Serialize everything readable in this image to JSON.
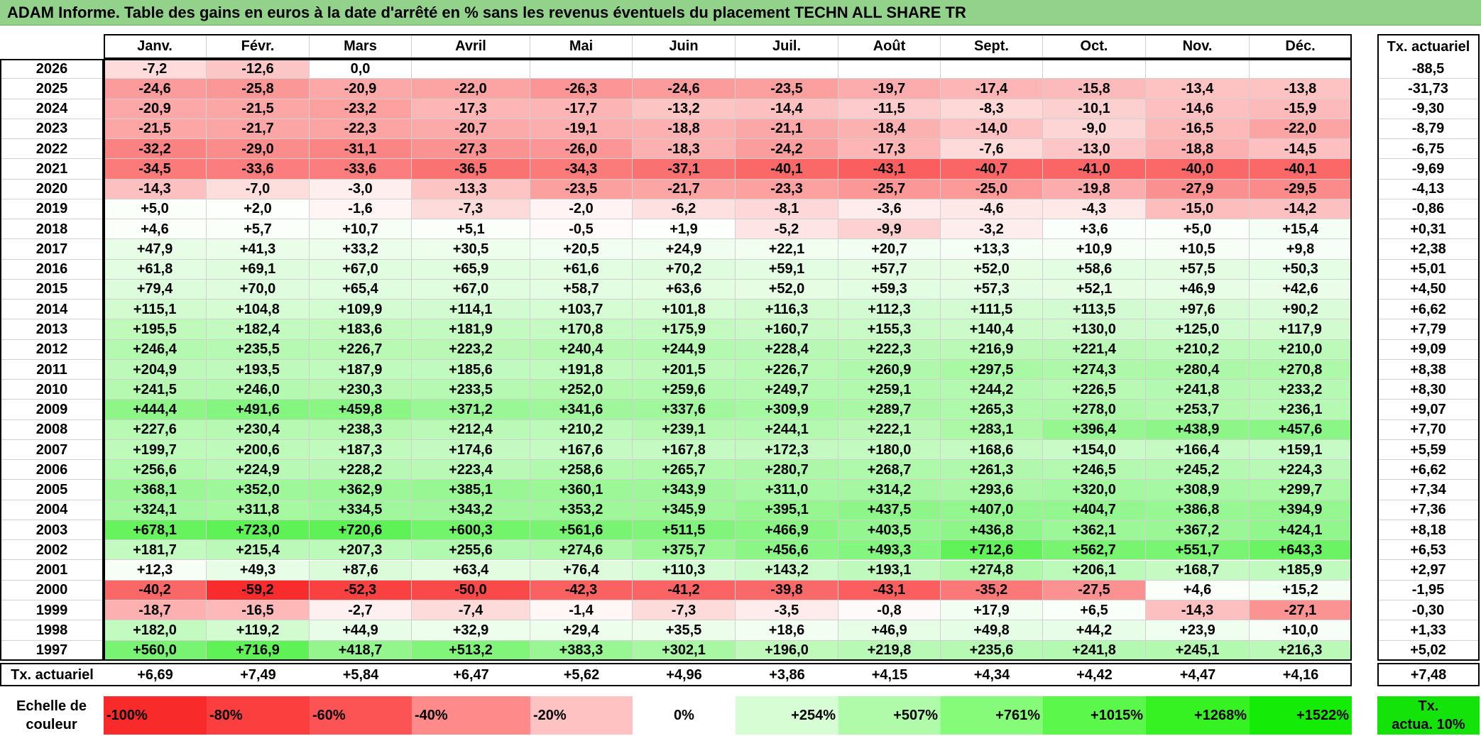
{
  "title": "ADAM Informe. Table des gains en euros à la date d'arrêté en % sans les revenus éventuels du placement TECHN ALL SHARE TR",
  "chart_data": {
    "type": "table",
    "months": [
      "Janv.",
      "Févr.",
      "Mars",
      "Avril",
      "Mai",
      "Juin",
      "Juil.",
      "Août",
      "Sept.",
      "Oct.",
      "Nov.",
      "Déc."
    ],
    "rate_header": "Tx. actuariel",
    "rows": [
      {
        "year": "2026",
        "values": [
          "-7,2",
          "-12,6",
          "0,0",
          "",
          "",
          "",
          "",
          "",
          "",
          "",
          "",
          ""
        ],
        "rate": "-88,5"
      },
      {
        "year": "2025",
        "values": [
          "-24,6",
          "-25,8",
          "-20,9",
          "-22,0",
          "-26,3",
          "-24,6",
          "-23,5",
          "-19,7",
          "-17,4",
          "-15,8",
          "-13,4",
          "-13,8"
        ],
        "rate": "-31,73"
      },
      {
        "year": "2024",
        "values": [
          "-20,9",
          "-21,5",
          "-23,2",
          "-17,3",
          "-17,7",
          "-13,2",
          "-14,4",
          "-11,5",
          "-8,3",
          "-10,1",
          "-14,6",
          "-15,9"
        ],
        "rate": "-9,30"
      },
      {
        "year": "2023",
        "values": [
          "-21,5",
          "-21,7",
          "-22,3",
          "-20,7",
          "-19,1",
          "-18,8",
          "-21,1",
          "-18,4",
          "-14,0",
          "-9,0",
          "-16,5",
          "-22,0"
        ],
        "rate": "-8,79"
      },
      {
        "year": "2022",
        "values": [
          "-32,2",
          "-29,0",
          "-31,1",
          "-27,3",
          "-26,0",
          "-18,3",
          "-24,2",
          "-17,3",
          "-7,6",
          "-13,0",
          "-18,8",
          "-14,5"
        ],
        "rate": "-6,75"
      },
      {
        "year": "2021",
        "values": [
          "-34,5",
          "-33,6",
          "-33,6",
          "-36,5",
          "-34,3",
          "-37,1",
          "-40,1",
          "-43,1",
          "-40,7",
          "-41,0",
          "-40,0",
          "-40,1"
        ],
        "rate": "-9,69"
      },
      {
        "year": "2020",
        "values": [
          "-14,3",
          "-7,0",
          "-3,0",
          "-13,3",
          "-23,5",
          "-21,7",
          "-23,3",
          "-25,7",
          "-25,0",
          "-19,8",
          "-27,9",
          "-29,5"
        ],
        "rate": "-4,13"
      },
      {
        "year": "2019",
        "values": [
          "+5,0",
          "+2,0",
          "-1,6",
          "-7,3",
          "-2,0",
          "-6,2",
          "-8,1",
          "-3,6",
          "-4,6",
          "-4,3",
          "-15,0",
          "-14,2"
        ],
        "rate": "-0,86"
      },
      {
        "year": "2018",
        "values": [
          "+4,6",
          "+5,7",
          "+10,7",
          "+5,1",
          "-0,5",
          "+1,9",
          "-5,2",
          "-9,9",
          "-3,2",
          "+3,6",
          "+5,0",
          "+15,4"
        ],
        "rate": "+0,31"
      },
      {
        "year": "2017",
        "values": [
          "+47,9",
          "+41,3",
          "+33,2",
          "+30,5",
          "+20,5",
          "+24,9",
          "+22,1",
          "+20,7",
          "+13,3",
          "+10,9",
          "+10,5",
          "+9,8"
        ],
        "rate": "+2,38"
      },
      {
        "year": "2016",
        "values": [
          "+61,8",
          "+69,1",
          "+67,0",
          "+65,9",
          "+61,6",
          "+70,2",
          "+59,1",
          "+57,7",
          "+52,0",
          "+58,6",
          "+57,5",
          "+50,3"
        ],
        "rate": "+5,01"
      },
      {
        "year": "2015",
        "values": [
          "+79,4",
          "+70,0",
          "+65,4",
          "+67,0",
          "+58,7",
          "+63,6",
          "+52,0",
          "+59,3",
          "+57,3",
          "+52,1",
          "+46,9",
          "+42,6"
        ],
        "rate": "+4,50"
      },
      {
        "year": "2014",
        "values": [
          "+115,1",
          "+104,8",
          "+109,9",
          "+114,1",
          "+103,7",
          "+101,8",
          "+116,3",
          "+112,3",
          "+111,5",
          "+113,5",
          "+97,6",
          "+90,2"
        ],
        "rate": "+6,62"
      },
      {
        "year": "2013",
        "values": [
          "+195,5",
          "+182,4",
          "+183,6",
          "+181,9",
          "+170,8",
          "+175,9",
          "+160,7",
          "+155,3",
          "+140,4",
          "+130,0",
          "+125,0",
          "+117,9"
        ],
        "rate": "+7,79"
      },
      {
        "year": "2012",
        "values": [
          "+246,4",
          "+235,5",
          "+226,7",
          "+223,2",
          "+240,4",
          "+244,9",
          "+228,4",
          "+222,3",
          "+216,9",
          "+221,4",
          "+210,2",
          "+210,0"
        ],
        "rate": "+9,09"
      },
      {
        "year": "2011",
        "values": [
          "+204,9",
          "+193,5",
          "+187,9",
          "+185,6",
          "+191,8",
          "+201,5",
          "+226,7",
          "+260,9",
          "+297,5",
          "+274,3",
          "+280,4",
          "+270,8"
        ],
        "rate": "+8,38"
      },
      {
        "year": "2010",
        "values": [
          "+241,5",
          "+246,0",
          "+230,3",
          "+233,5",
          "+252,0",
          "+259,6",
          "+249,7",
          "+259,1",
          "+244,2",
          "+226,5",
          "+241,8",
          "+233,2"
        ],
        "rate": "+8,30"
      },
      {
        "year": "2009",
        "values": [
          "+444,4",
          "+491,6",
          "+459,8",
          "+371,2",
          "+341,6",
          "+337,6",
          "+309,9",
          "+289,7",
          "+265,3",
          "+278,0",
          "+253,7",
          "+236,1"
        ],
        "rate": "+9,07"
      },
      {
        "year": "2008",
        "values": [
          "+227,6",
          "+230,4",
          "+238,3",
          "+212,4",
          "+210,2",
          "+239,1",
          "+244,1",
          "+222,1",
          "+283,1",
          "+396,4",
          "+438,9",
          "+457,6"
        ],
        "rate": "+7,70"
      },
      {
        "year": "2007",
        "values": [
          "+199,7",
          "+200,6",
          "+187,3",
          "+174,6",
          "+167,6",
          "+167,8",
          "+172,3",
          "+180,0",
          "+168,6",
          "+154,0",
          "+166,4",
          "+159,1"
        ],
        "rate": "+5,59"
      },
      {
        "year": "2006",
        "values": [
          "+256,6",
          "+224,9",
          "+228,2",
          "+223,4",
          "+258,6",
          "+265,7",
          "+280,7",
          "+268,7",
          "+261,3",
          "+246,5",
          "+245,2",
          "+224,3"
        ],
        "rate": "+6,62"
      },
      {
        "year": "2005",
        "values": [
          "+368,1",
          "+352,0",
          "+362,9",
          "+385,1",
          "+360,1",
          "+343,9",
          "+311,0",
          "+314,2",
          "+293,6",
          "+320,0",
          "+308,9",
          "+299,7"
        ],
        "rate": "+7,34"
      },
      {
        "year": "2004",
        "values": [
          "+324,1",
          "+311,8",
          "+334,5",
          "+343,2",
          "+353,2",
          "+345,9",
          "+395,1",
          "+437,5",
          "+407,0",
          "+404,7",
          "+386,8",
          "+394,9"
        ],
        "rate": "+7,36"
      },
      {
        "year": "2003",
        "values": [
          "+678,1",
          "+723,0",
          "+720,6",
          "+600,3",
          "+561,6",
          "+511,5",
          "+466,9",
          "+403,5",
          "+436,8",
          "+362,1",
          "+367,2",
          "+424,1"
        ],
        "rate": "+8,18"
      },
      {
        "year": "2002",
        "values": [
          "+181,7",
          "+215,4",
          "+207,3",
          "+255,6",
          "+274,6",
          "+375,7",
          "+456,6",
          "+493,3",
          "+712,6",
          "+562,7",
          "+551,7",
          "+643,3"
        ],
        "rate": "+6,53"
      },
      {
        "year": "2001",
        "values": [
          "+12,3",
          "+49,3",
          "+87,6",
          "+63,4",
          "+76,4",
          "+110,3",
          "+143,2",
          "+193,1",
          "+274,8",
          "+206,1",
          "+168,7",
          "+185,9"
        ],
        "rate": "+2,97"
      },
      {
        "year": "2000",
        "values": [
          "-40,2",
          "-59,2",
          "-52,3",
          "-50,0",
          "-42,3",
          "-41,2",
          "-39,8",
          "-43,1",
          "-35,2",
          "-27,5",
          "+4,6",
          "+15,2"
        ],
        "rate": "-1,95"
      },
      {
        "year": "1999",
        "values": [
          "-18,7",
          "-16,5",
          "-2,7",
          "-7,4",
          "-1,4",
          "-7,3",
          "-3,5",
          "-0,8",
          "+17,9",
          "+6,5",
          "-14,3",
          "-27,1"
        ],
        "rate": "-0,30"
      },
      {
        "year": "1998",
        "values": [
          "+182,0",
          "+119,2",
          "+44,9",
          "+32,9",
          "+29,4",
          "+35,5",
          "+18,6",
          "+46,9",
          "+49,8",
          "+44,2",
          "+23,9",
          "+10,0"
        ],
        "rate": "+1,33"
      },
      {
        "year": "1997",
        "values": [
          "+560,0",
          "+716,9",
          "+418,7",
          "+513,2",
          "+383,3",
          "+302,1",
          "+196,0",
          "+219,8",
          "+235,6",
          "+241,8",
          "+245,1",
          "+216,3"
        ],
        "rate": "+5,02"
      }
    ],
    "footer": {
      "label": "Tx. actuariel",
      "values": [
        "+6,69",
        "+7,49",
        "+5,84",
        "+6,47",
        "+5,62",
        "+4,96",
        "+3,86",
        "+4,15",
        "+4,34",
        "+4,42",
        "+4,47",
        "+4,16"
      ],
      "rate": "+7,48"
    },
    "scale": {
      "label_line1": "Echelle de",
      "label_line2": "couleur",
      "steps": [
        {
          "text": "-100%",
          "color": "#f82a2a",
          "align": "left"
        },
        {
          "text": "-80%",
          "color": "#fb3e3e",
          "align": "left"
        },
        {
          "text": "-60%",
          "color": "#fc5454",
          "align": "left"
        },
        {
          "text": "-40%",
          "color": "#fe8a8a",
          "align": "left"
        },
        {
          "text": "-20%",
          "color": "#ffc2c2",
          "align": "left"
        },
        {
          "text": "0%",
          "color": "#ffffff",
          "align": "center"
        },
        {
          "text": "+254%",
          "color": "#d7fdd4",
          "align": "right"
        },
        {
          "text": "+507%",
          "color": "#b0fba9",
          "align": "right"
        },
        {
          "text": "+761%",
          "color": "#86fa79",
          "align": "right"
        },
        {
          "text": "+1015%",
          "color": "#5cf74b",
          "align": "right"
        },
        {
          "text": "+1268%",
          "color": "#36f222",
          "align": "right"
        },
        {
          "text": "+1522%",
          "color": "#14ec08",
          "align": "right"
        }
      ],
      "rate_line1": "Tx.",
      "rate_line2": "actua. 10%",
      "rate_color": "#14e30a"
    },
    "colors": {
      "title_bg": "#92d28a",
      "negative_max": "#f82a2a",
      "neutral": "#ffffff",
      "positive_max": "#14ec08"
    }
  }
}
